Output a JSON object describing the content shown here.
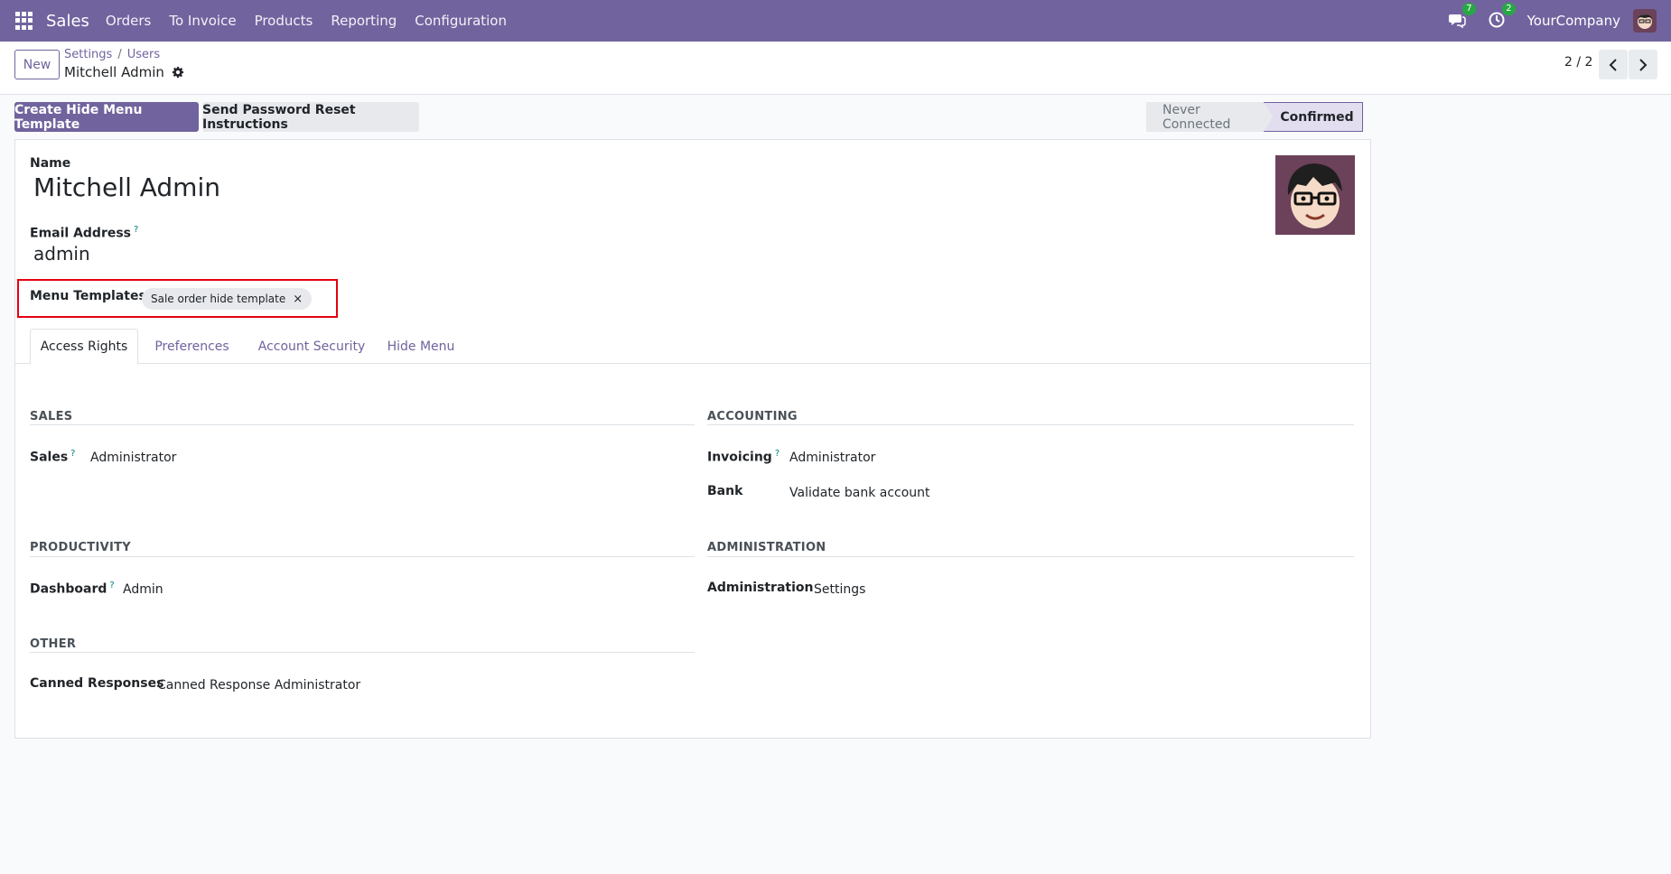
{
  "nav": {
    "app_name": "Sales",
    "menu": [
      "Orders",
      "To Invoice",
      "Products",
      "Reporting",
      "Configuration"
    ],
    "messages_count": "7",
    "activities_count": "2",
    "company": "YourCompany"
  },
  "control": {
    "new_label": "New",
    "breadcrumb": [
      "Settings",
      "Users"
    ],
    "breadcrumb_sep": "/",
    "record_title": "Mitchell Admin",
    "pager": "2 / 2"
  },
  "actions": {
    "create_template": "Create Hide Menu Template",
    "send_reset": "Send Password Reset Instructions"
  },
  "status": {
    "never_connected": "Never Connected",
    "confirmed": "Confirmed"
  },
  "form": {
    "name_label": "Name",
    "name_value": "Mitchell Admin",
    "email_label": "Email Address",
    "email_help": "?",
    "email_value": "admin",
    "menu_templates_label": "Menu Templates",
    "menu_template_tag": "Sale order hide template",
    "tag_remove": "×"
  },
  "tabs": [
    "Access Rights",
    "Preferences",
    "Account Security",
    "Hide Menu"
  ],
  "access": {
    "sales": {
      "title": "SALES",
      "field_label": "Sales",
      "field_help": "?",
      "field_value": "Administrator"
    },
    "accounting": {
      "title": "ACCOUNTING",
      "invoicing_label": "Invoicing",
      "invoicing_help": "?",
      "invoicing_value": "Administrator",
      "bank_label": "Bank",
      "bank_value": "Validate bank account"
    },
    "productivity": {
      "title": "PRODUCTIVITY",
      "dashboard_label": "Dashboard",
      "dashboard_help": "?",
      "dashboard_value": "Admin"
    },
    "administration": {
      "title": "ADMINISTRATION",
      "field_label": "Administration",
      "field_value": "Settings"
    },
    "other": {
      "title": "OTHER",
      "canned_label": "Canned Responses",
      "canned_value": "Canned Response Administrator"
    }
  },
  "colors": {
    "brand": "#71639e",
    "badge": "#28a745",
    "highlight": "#e60012"
  }
}
